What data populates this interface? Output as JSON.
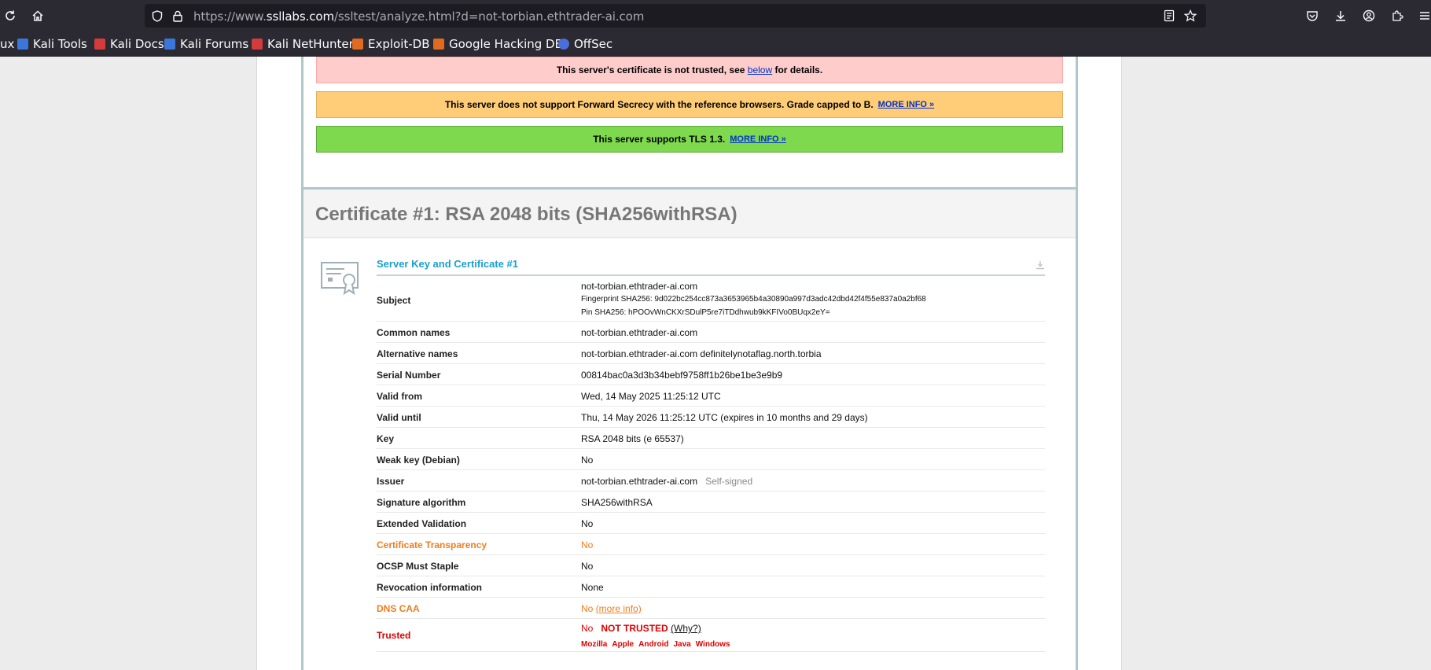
{
  "browser": {
    "url_prefix": "https://www.",
    "url_domain": "ssllabs.com",
    "url_path": "/ssltest/analyze.html?d=not-torbian.ethtrader-ai.com",
    "bookmarks": [
      {
        "label": "ux",
        "color": "#2b2a33"
      },
      {
        "label": "Kali Tools",
        "color": "#3a77d8"
      },
      {
        "label": "Kali Docs",
        "color": "#d63b3b"
      },
      {
        "label": "Kali Forums",
        "color": "#3a77d8"
      },
      {
        "label": "Kali NetHunter",
        "color": "#d63b3b"
      },
      {
        "label": "Exploit-DB",
        "color": "#e06a1f"
      },
      {
        "label": "Google Hacking DB",
        "color": "#e06a1f"
      },
      {
        "label": "OffSec",
        "color": "#4a6fd8"
      }
    ]
  },
  "banners": {
    "not_trusted_pre": "This server's certificate is not trusted, see",
    "not_trusted_link": "below",
    "not_trusted_post": "for details.",
    "fs_text": "This server does not support Forward Secrecy with the reference browsers. Grade capped to B.",
    "fs_more": "MORE INFO »",
    "tls_text": "This server supports TLS 1.3.",
    "tls_more": "MORE INFO »"
  },
  "certificate": {
    "title": "Certificate #1: RSA 2048 bits (SHA256withRSA)",
    "section_title": "Server Key and Certificate #1",
    "subject": {
      "label": "Subject",
      "name": "not-torbian.ethtrader-ai.com",
      "fingerprint": "Fingerprint SHA256: 9d022bc254cc873a3653965b4a30890a997d3adc42dbd42f4f55e837a0a2bf68",
      "pin": "Pin SHA256: hPOOvWnCKXrSDulP5re7iTDdhwub9kKFIVo0BUqx2eY="
    },
    "rows": {
      "common_names": {
        "label": "Common names",
        "value": "not-torbian.ethtrader-ai.com"
      },
      "alt_names": {
        "label": "Alternative names",
        "value": "not-torbian.ethtrader-ai.com definitelynotaflag.north.torbia"
      },
      "serial": {
        "label": "Serial Number",
        "value": "00814bac0a3d3b34bebf9758ff1b26be1be3e9b9"
      },
      "valid_from": {
        "label": "Valid from",
        "value": "Wed, 14 May 2025 11:25:12 UTC"
      },
      "valid_until": {
        "label": "Valid until",
        "value": "Thu, 14 May 2026 11:25:12 UTC (expires in 10 months and 29 days)"
      },
      "key": {
        "label": "Key",
        "value": "RSA 2048 bits (e 65537)"
      },
      "weak_key": {
        "label": "Weak key (Debian)",
        "value": "No"
      },
      "issuer": {
        "label": "Issuer",
        "value": "not-torbian.ethtrader-ai.com",
        "note": "Self-signed"
      },
      "sig_alg": {
        "label": "Signature algorithm",
        "value": "SHA256withRSA"
      },
      "ev": {
        "label": "Extended Validation",
        "value": "No"
      },
      "ct": {
        "label": "Certificate Transparency",
        "value": "No"
      },
      "ocsp": {
        "label": "OCSP Must Staple",
        "value": "No"
      },
      "revocation": {
        "label": "Revocation information",
        "value": "None"
      },
      "dns_caa": {
        "label": "DNS CAA",
        "value": "No",
        "link": "(more info)"
      },
      "trusted": {
        "label": "Trusted",
        "value": "No",
        "status": "NOT TRUSTED",
        "why": "(Why?)",
        "browsers": [
          "Mozilla",
          "Apple",
          "Android",
          "Java",
          "Windows"
        ]
      }
    }
  }
}
